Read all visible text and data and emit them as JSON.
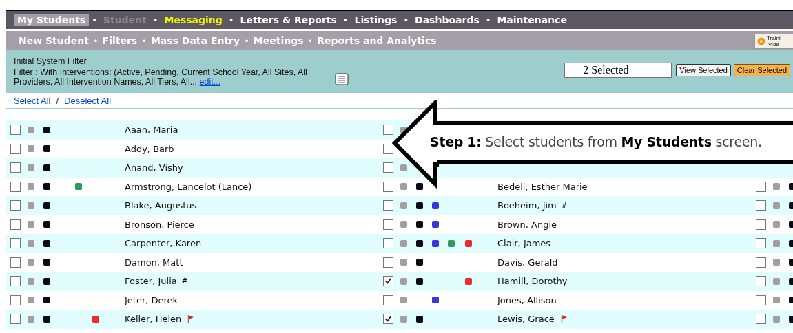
{
  "nav": {
    "separator": "•",
    "items": [
      {
        "label": "My Students",
        "selected": true,
        "disabled": false,
        "highlight": false
      },
      {
        "label": "Student",
        "selected": false,
        "disabled": true,
        "highlight": false
      },
      {
        "label": "Messaging",
        "selected": false,
        "disabled": false,
        "highlight": true
      },
      {
        "label": "Letters & Reports",
        "selected": false,
        "disabled": false,
        "highlight": false
      },
      {
        "label": "Listings",
        "selected": false,
        "disabled": false,
        "highlight": false
      },
      {
        "label": "Dashboards",
        "selected": false,
        "disabled": false,
        "highlight": false
      },
      {
        "label": "Maintenance",
        "selected": false,
        "disabled": false,
        "highlight": false
      }
    ]
  },
  "subnav": {
    "separator": "•",
    "items": [
      "New Student",
      "Filters",
      "Mass Data Entry",
      "Meetings",
      "Reports and Analytics"
    ]
  },
  "training_button": {
    "lines": [
      "Traini",
      "Vide"
    ]
  },
  "filter": {
    "title": "Initial System Filter",
    "text": "Filter : With Interventions: (Active, Pending, Current School Year, All Sites, All Providers, All Intervention Names, All Tiers, All...",
    "edit_link": "edit..."
  },
  "selection": {
    "count": "2 Selected",
    "buttons": [
      {
        "label": "View Selected",
        "kind": "plain"
      },
      {
        "label": "Clear Selected",
        "kind": "accent"
      }
    ]
  },
  "select_links": {
    "select_all": "Select All",
    "separator": "/",
    "deselect_all": "Deselect All"
  },
  "rows": [
    {
      "cells": [
        {
          "checked": false,
          "markers": {
            "black": true,
            "blue": false,
            "green": false,
            "red": false
          },
          "name": "Aaan, Maria"
        },
        {
          "checked": false
        }
      ]
    },
    {
      "cells": [
        {
          "checked": false,
          "markers": {
            "black": true,
            "blue": false,
            "green": false,
            "red": false
          },
          "name": "Addy, Barb"
        },
        {
          "checked": false
        }
      ]
    },
    {
      "cells": [
        {
          "checked": false,
          "markers": {
            "black": true,
            "blue": false,
            "green": false,
            "red": false
          },
          "name": "Anand, Vishy"
        },
        {
          "checked": false
        }
      ]
    },
    {
      "cells": [
        {
          "checked": false,
          "markers": {
            "black": true,
            "blue": false,
            "green": true,
            "red": false
          },
          "name": "Armstrong, Lancelot (Lance)"
        },
        {
          "checked": false,
          "markers": {
            "black": true,
            "blue": false,
            "green": false,
            "red": false
          },
          "name": "Bedell, Esther Marie"
        },
        {
          "checked": false,
          "markers": {
            "black": true
          }
        }
      ]
    },
    {
      "cells": [
        {
          "checked": false,
          "markers": {
            "black": true,
            "blue": false,
            "green": false,
            "red": false
          },
          "name": "Blake, Augustus"
        },
        {
          "checked": false,
          "markers": {
            "black": true,
            "blue": true,
            "green": false,
            "red": false
          },
          "name": "Boeheim, Jim",
          "note": "#"
        },
        {
          "checked": false,
          "markers": {
            "black": true
          }
        }
      ]
    },
    {
      "cells": [
        {
          "checked": false,
          "markers": {
            "black": true,
            "blue": false,
            "green": false,
            "red": false
          },
          "name": "Bronson, Pierce"
        },
        {
          "checked": false,
          "markers": {
            "black": true,
            "blue": true,
            "green": false,
            "red": false
          },
          "name": "Brown, Angie"
        },
        {
          "checked": false,
          "markers": {
            "black": true
          }
        }
      ]
    },
    {
      "cells": [
        {
          "checked": false,
          "markers": {
            "black": true,
            "blue": false,
            "green": false,
            "red": false
          },
          "name": "Carpenter, Karen"
        },
        {
          "checked": false,
          "markers": {
            "black": true,
            "blue": true,
            "green": true,
            "red": true
          },
          "name": "Clair, James"
        },
        {
          "checked": false,
          "markers": {
            "black": true
          }
        }
      ]
    },
    {
      "cells": [
        {
          "checked": false,
          "markers": {
            "black": true,
            "blue": false,
            "green": false,
            "red": false
          },
          "name": "Damon, Matt"
        },
        {
          "checked": false,
          "markers": {
            "black": true,
            "blue": false,
            "green": false,
            "red": false
          },
          "name": "Davis, Gerald"
        },
        {
          "checked": false,
          "markers": {
            "black": true
          }
        }
      ]
    },
    {
      "cells": [
        {
          "checked": false,
          "markers": {
            "black": true,
            "blue": false,
            "green": false,
            "red": false
          },
          "name": "Foster, Julia",
          "note": "#"
        },
        {
          "checked": true,
          "markers": {
            "black": true,
            "blue": false,
            "green": false,
            "red": true
          },
          "name": "Hamill, Dorothy"
        },
        {
          "checked": false,
          "markers": {
            "black": true
          }
        }
      ]
    },
    {
      "cells": [
        {
          "checked": false,
          "markers": {
            "black": true,
            "blue": false,
            "green": false,
            "red": false
          },
          "name": "Jeter, Derek"
        },
        {
          "checked": false,
          "markers": {
            "black": false,
            "blue": true,
            "green": false,
            "red": false
          },
          "name": "Jones, Allison"
        },
        {
          "checked": false,
          "markers": {
            "black": true
          }
        }
      ]
    },
    {
      "cells": [
        {
          "checked": false,
          "markers": {
            "black": true,
            "blue": false,
            "green": false,
            "red": true
          },
          "name": "Keller, Helen",
          "flag": true
        },
        {
          "checked": true,
          "markers": {
            "black": true,
            "blue": false,
            "green": false,
            "red": false
          },
          "name": "Lewis, Grace",
          "flag": true
        },
        {
          "checked": false,
          "markers": {
            "black": true
          }
        }
      ]
    }
  ],
  "callout": {
    "text": "**Step 1:** Select students from **My Students** screen."
  }
}
